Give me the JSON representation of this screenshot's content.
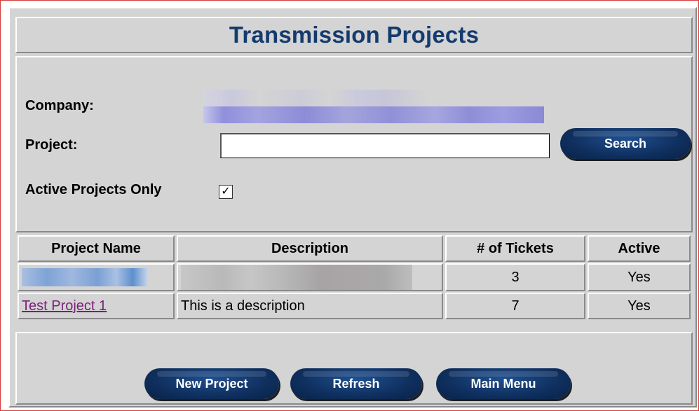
{
  "page": {
    "title": "Transmission Projects"
  },
  "form": {
    "company_label": "Company:",
    "project_label": "Project:",
    "project_value": "",
    "search_label": "Search",
    "active_only_label": "Active Projects Only",
    "active_only_checked": true,
    "checkbox_glyph": "✓"
  },
  "table": {
    "headers": [
      "Project Name",
      "Description",
      "# of Tickets",
      "Active"
    ],
    "rows": [
      {
        "name": "",
        "description": "",
        "tickets": "3",
        "active": "Yes"
      },
      {
        "name": "Test Project 1",
        "description": "This is a description",
        "tickets": "7",
        "active": "Yes"
      }
    ]
  },
  "buttons": {
    "new_project": "New Project",
    "refresh": "Refresh",
    "main_menu": "Main Menu"
  },
  "colors": {
    "title": "#143b6e",
    "button": "#0f2f5e",
    "link": "#7a1f7a",
    "panel": "#d4d4d4"
  }
}
